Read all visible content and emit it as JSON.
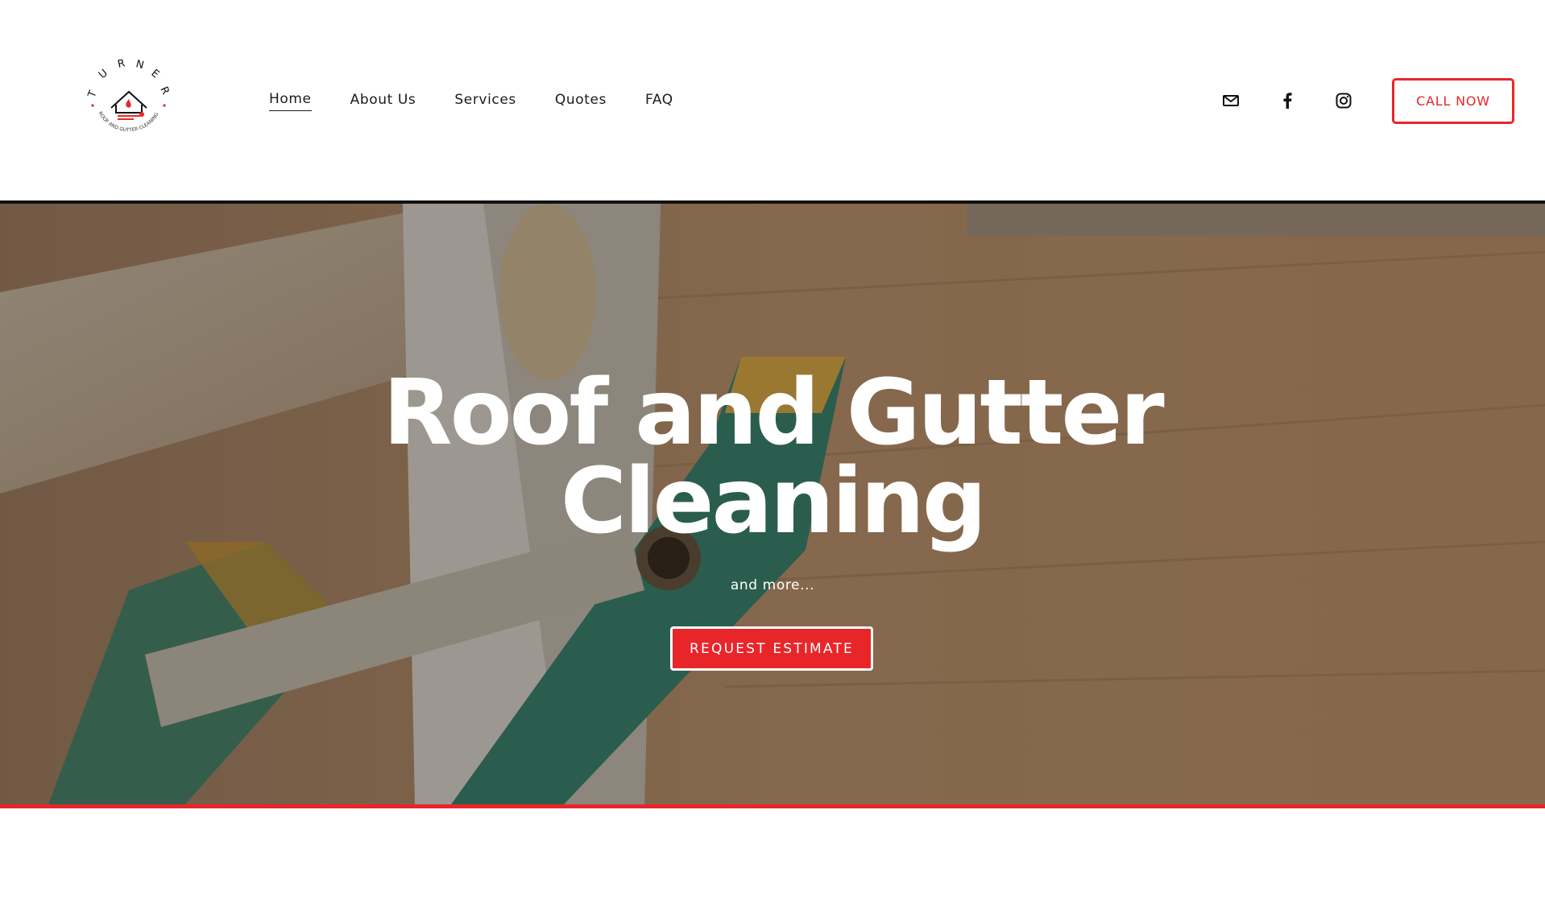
{
  "brand": {
    "logo_word": "TURNER",
    "logo_tagline": "ROOF AND GUTTER CLEANING",
    "accent_color": "#e8262a"
  },
  "nav": {
    "items": [
      {
        "label": "Home",
        "active": true
      },
      {
        "label": "About Us",
        "active": false
      },
      {
        "label": "Services",
        "active": false
      },
      {
        "label": "Quotes",
        "active": false
      },
      {
        "label": "FAQ",
        "active": false
      }
    ]
  },
  "social": {
    "icons": [
      "mail-icon",
      "facebook-icon",
      "instagram-icon"
    ]
  },
  "header": {
    "call_label": "CALL NOW"
  },
  "hero": {
    "title_line1": "Roof and Gutter",
    "title_line2": "Cleaning",
    "subtitle": "and more...",
    "cta_label": "REQUEST ESTIMATE"
  }
}
